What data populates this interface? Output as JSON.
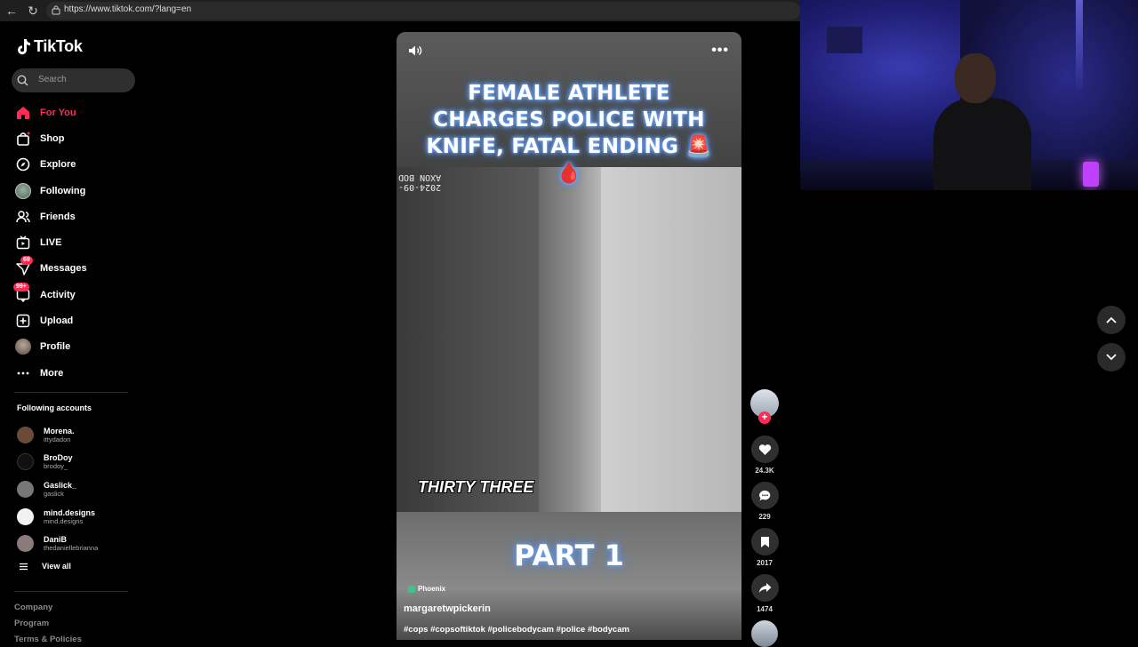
{
  "browser": {
    "url": "https://www.tiktok.com/?lang=en"
  },
  "sidebar": {
    "logo": "TikTok",
    "search_placeholder": "Search",
    "nav": [
      {
        "label": "For You",
        "icon": "home-icon",
        "active": true
      },
      {
        "label": "Shop",
        "icon": "shop-icon"
      },
      {
        "label": "Explore",
        "icon": "compass-icon"
      },
      {
        "label": "Following",
        "icon": "following-avatar-icon"
      },
      {
        "label": "Friends",
        "icon": "friends-icon"
      },
      {
        "label": "LIVE",
        "icon": "live-icon"
      },
      {
        "label": "Messages",
        "icon": "messages-icon",
        "badge": "69"
      },
      {
        "label": "Activity",
        "icon": "activity-icon",
        "badge": "99+"
      },
      {
        "label": "Upload",
        "icon": "upload-icon"
      },
      {
        "label": "Profile",
        "icon": "profile-avatar-icon"
      },
      {
        "label": "More",
        "icon": "more-icon"
      }
    ],
    "following_title": "Following accounts",
    "following": [
      {
        "name": "Morena.",
        "handle": "ittydadon",
        "color": "#6b4a3a"
      },
      {
        "name": "BroDoy",
        "handle": "brodoy_",
        "color": "#111111"
      },
      {
        "name": "Gaslick_",
        "handle": "gaslick",
        "color": "#777777"
      },
      {
        "name": "mind.designs",
        "handle": "mind.designs",
        "color": "#f2f2f2"
      },
      {
        "name": "DaniB",
        "handle": "thedaniellebrianna",
        "color": "#8a7a7a"
      }
    ],
    "view_all": "View all",
    "footer": [
      "Company",
      "Program",
      "Terms & Policies"
    ]
  },
  "video": {
    "title": "FEMALE ATHLETE CHARGES POLICE WITH KNIFE, FATAL ENDING 🚨🩸",
    "overlay_stamp": [
      "2024-09-",
      "AXON BOD"
    ],
    "caption_mid": "THIRTY THREE",
    "caption_part": "PART 1",
    "tag": "Phoenix",
    "author": "margaretwpickerin",
    "hashtags": "#cops #copsoftiktok #policebodycam #police #bodycam"
  },
  "actions": {
    "likes": "24.3K",
    "comments": "229",
    "saves": "2017",
    "shares": "1474"
  },
  "colors": {
    "accent": "#fe2c55",
    "background": "#000000",
    "panel": "#2f2f2f"
  }
}
